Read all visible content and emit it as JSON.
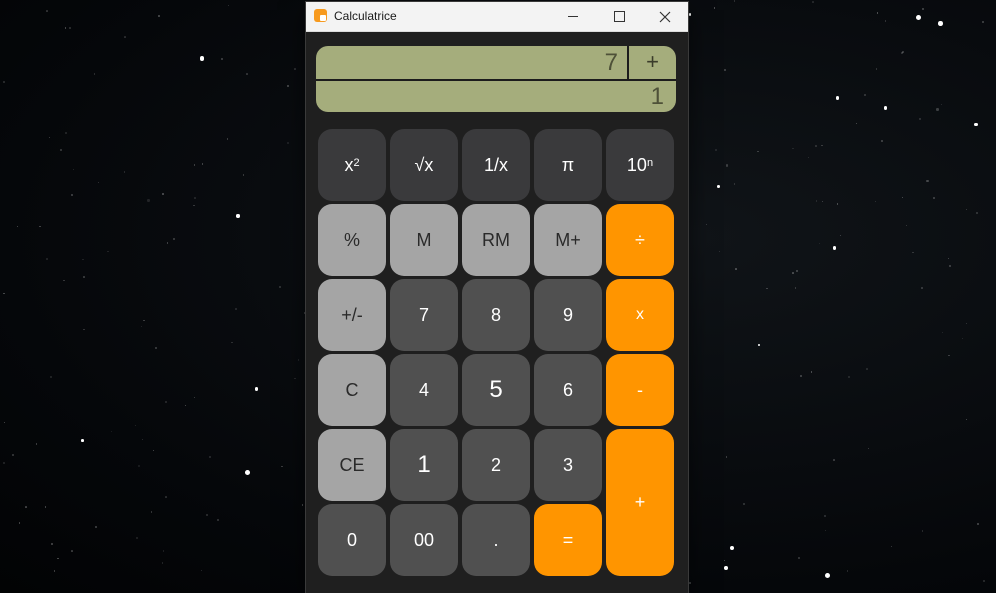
{
  "window": {
    "title": "Calculatrice",
    "controls": [
      "minimize",
      "maximize",
      "close"
    ]
  },
  "display": {
    "expression_value": "7",
    "operator": "+",
    "result_value": "1",
    "background_color": "#a5ad7c"
  },
  "keys": {
    "square": {
      "base": "x",
      "sup": "2"
    },
    "sqrt": "√x",
    "reciprocal": "1/x",
    "pi": "π",
    "pow10": {
      "base": "10",
      "sup": "n"
    },
    "percent": "%",
    "memory": "M",
    "recall_memory": "RM",
    "memory_add": "M+",
    "divide": "÷",
    "sign": "+/-",
    "seven": "7",
    "eight": "8",
    "nine": "9",
    "multiply": "x",
    "clear": "C",
    "four": "4",
    "five": "5",
    "six": "6",
    "subtract": "-",
    "clear_entry": "CE",
    "one": "1",
    "two": "2",
    "three": "3",
    "add": "+",
    "zero": "0",
    "double_zero": "00",
    "decimal": ".",
    "equals": "="
  },
  "colors": {
    "accent": "#ff9500",
    "key_dark": "#3a3a3c",
    "key_number": "#505050",
    "key_light": "#a5a5a5"
  }
}
